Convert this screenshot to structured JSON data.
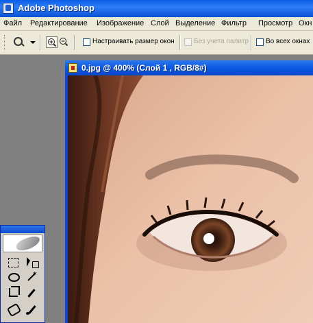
{
  "app": {
    "title": "Adobe Photoshop"
  },
  "menu": [
    "Файл",
    "Редактирование",
    "Изображение",
    "Слой",
    "Выделение",
    "Фильтр",
    "Просмотр",
    "Окн"
  ],
  "options": {
    "tool_icon": "zoom-icon",
    "zoom_in_icon": "zoom-in-icon",
    "zoom_out_icon": "zoom-out-icon",
    "checkboxes": [
      {
        "label": "Настраивать размер окон",
        "checked": false,
        "enabled": true
      },
      {
        "label": "Без учета палитр",
        "checked": false,
        "enabled": false
      },
      {
        "label": "Во всех окнах",
        "checked": false,
        "enabled": true
      }
    ]
  },
  "document": {
    "title": "0.jpg @ 400% (Слой 1 , RGB/8#)"
  },
  "colors": {
    "titlebar": "#0a5de8",
    "menubar": "#ece9d8",
    "workspace": "#808080",
    "skin": "#e6b9a0",
    "hair": "#5a2e1c",
    "iris": "#6a3a22"
  },
  "toolbox": {
    "tools": [
      "marquee-icon",
      "move-icon",
      "lasso-icon",
      "magic-wand-icon",
      "crop-icon",
      "slice-icon",
      "healing-brush-icon",
      "brush-icon"
    ]
  }
}
